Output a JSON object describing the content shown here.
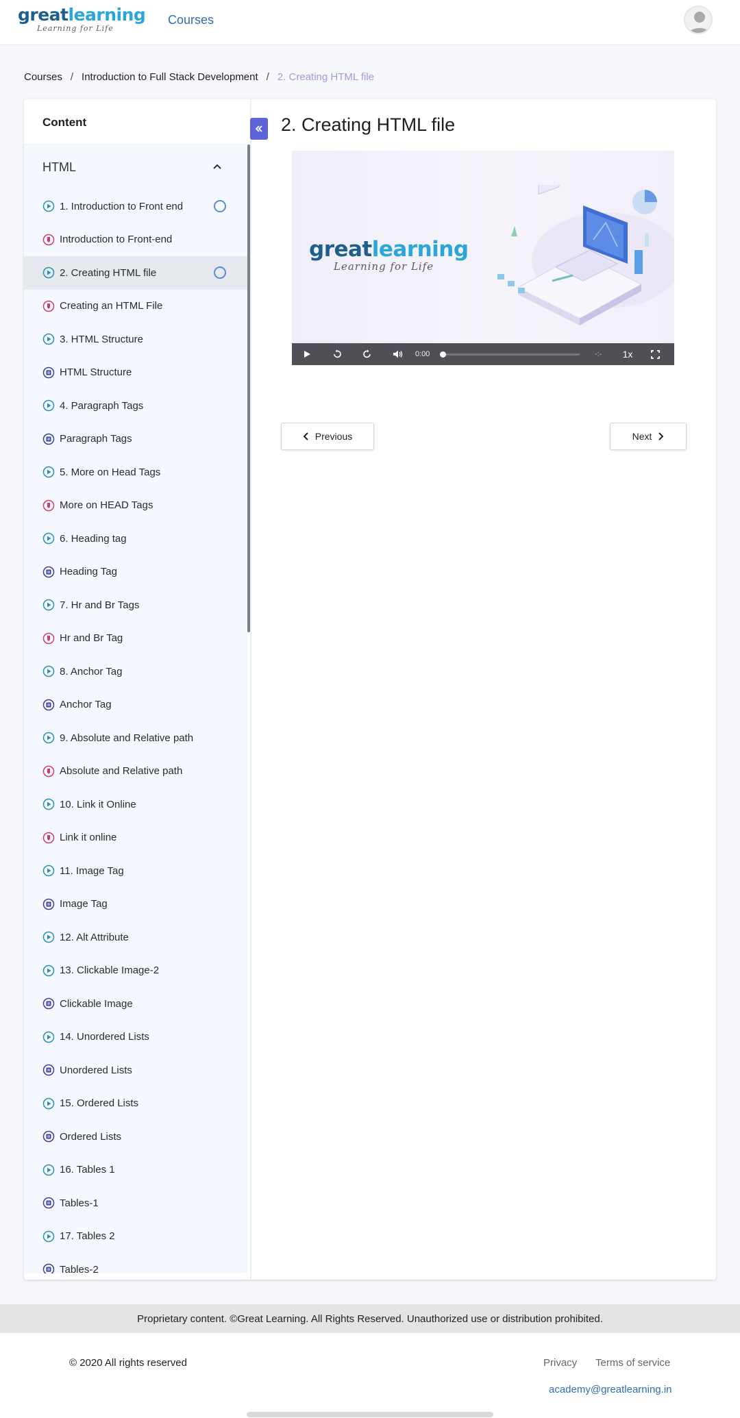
{
  "header": {
    "logo_main_a": "great",
    "logo_main_b": "learning",
    "logo_sub": "Learning for Life",
    "nav_courses": "Courses"
  },
  "breadcrumb": {
    "items": [
      "Courses",
      "Introduction to Full Stack Development"
    ],
    "separator": "/",
    "active": "2. Creating HTML file"
  },
  "sidebar": {
    "title": "Content",
    "section": "HTML",
    "items": [
      {
        "label": "1. Introduction to Front end",
        "type": "video",
        "ring": true
      },
      {
        "label": "Introduction to Front-end",
        "type": "note"
      },
      {
        "label": "2. Creating HTML file",
        "type": "video",
        "ring": true,
        "selected": true
      },
      {
        "label": "Creating an HTML File",
        "type": "note"
      },
      {
        "label": "3. HTML Structure",
        "type": "video"
      },
      {
        "label": "HTML Structure",
        "type": "quiz"
      },
      {
        "label": "4. Paragraph Tags",
        "type": "video"
      },
      {
        "label": "Paragraph Tags",
        "type": "quiz"
      },
      {
        "label": "5. More on Head Tags",
        "type": "video"
      },
      {
        "label": "More on HEAD Tags",
        "type": "note"
      },
      {
        "label": "6. Heading tag",
        "type": "video"
      },
      {
        "label": "Heading Tag",
        "type": "quiz"
      },
      {
        "label": "7. Hr and Br Tags",
        "type": "video"
      },
      {
        "label": "Hr and Br Tag",
        "type": "note"
      },
      {
        "label": "8. Anchor Tag",
        "type": "video"
      },
      {
        "label": "Anchor Tag",
        "type": "quiz"
      },
      {
        "label": "9. Absolute and Relative path",
        "type": "video"
      },
      {
        "label": "Absolute and Relative path",
        "type": "note"
      },
      {
        "label": "10. Link it Online",
        "type": "video"
      },
      {
        "label": "Link it online",
        "type": "note"
      },
      {
        "label": "11. Image Tag",
        "type": "video"
      },
      {
        "label": "Image Tag",
        "type": "quiz"
      },
      {
        "label": "12. Alt Attribute",
        "type": "video"
      },
      {
        "label": "13. Clickable Image-2",
        "type": "video"
      },
      {
        "label": "Clickable Image",
        "type": "quiz"
      },
      {
        "label": "14. Unordered Lists",
        "type": "video"
      },
      {
        "label": "Unordered Lists",
        "type": "quiz"
      },
      {
        "label": "15. Ordered Lists",
        "type": "video"
      },
      {
        "label": "Ordered Lists",
        "type": "quiz"
      },
      {
        "label": "16. Tables 1",
        "type": "video"
      },
      {
        "label": "Tables-1",
        "type": "quiz"
      },
      {
        "label": "17. Tables 2",
        "type": "video"
      },
      {
        "label": "Tables-2",
        "type": "quiz"
      }
    ]
  },
  "lesson": {
    "title": "2. Creating HTML file",
    "video": {
      "time": "0:00",
      "remaining": "-:-",
      "speed": "1x",
      "progress": 0
    },
    "prev_label": "Previous",
    "next_label": "Next"
  },
  "footer": {
    "proprietary": "Proprietary content. ©Great Learning. All Rights Reserved. Unauthorized use or distribution prohibited.",
    "copyright": "© 2020 All rights reserved",
    "privacy": "Privacy",
    "terms": "Terms of service",
    "email": "academy@greatlearning.in"
  },
  "colors": {
    "accent": "#5e63d8",
    "link": "#2f6db5",
    "video_icon": "#2a8fb3",
    "note_icon": "#d23c6a",
    "quiz_icon": "#3b3f9c",
    "breadcrumb_active": "#a19be0"
  }
}
